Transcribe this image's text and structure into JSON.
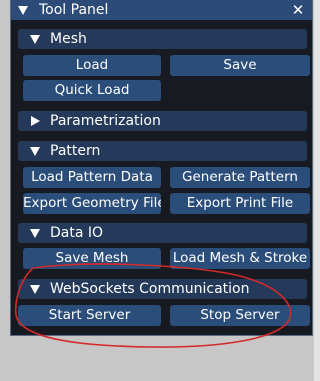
{
  "window": {
    "title": "Tool Panel",
    "close_label": "✕"
  },
  "sections": {
    "mesh": {
      "label": "Mesh",
      "load": "Load",
      "save": "Save",
      "quick_load": "Quick Load"
    },
    "parametrization": {
      "label": "Parametrization"
    },
    "pattern": {
      "label": "Pattern",
      "load_pattern_data": "Load Pattern Data",
      "generate_pattern": "Generate Pattern",
      "export_geometry_file": "Export Geometry File",
      "export_print_file": "Export Print File"
    },
    "data_io": {
      "label": "Data IO",
      "save_mesh": "Save Mesh",
      "load_mesh_stroke": "Load Mesh & Stroke"
    },
    "websockets": {
      "label": "WebSockets Communication",
      "start_server": "Start Server",
      "stop_server": "Stop Server"
    }
  },
  "colors": {
    "panel_bg": "#171a20",
    "title_bar": "#2c4b78",
    "header": "#253a5a",
    "button": "#2a4d7a",
    "annotation": "#d42a2a"
  }
}
